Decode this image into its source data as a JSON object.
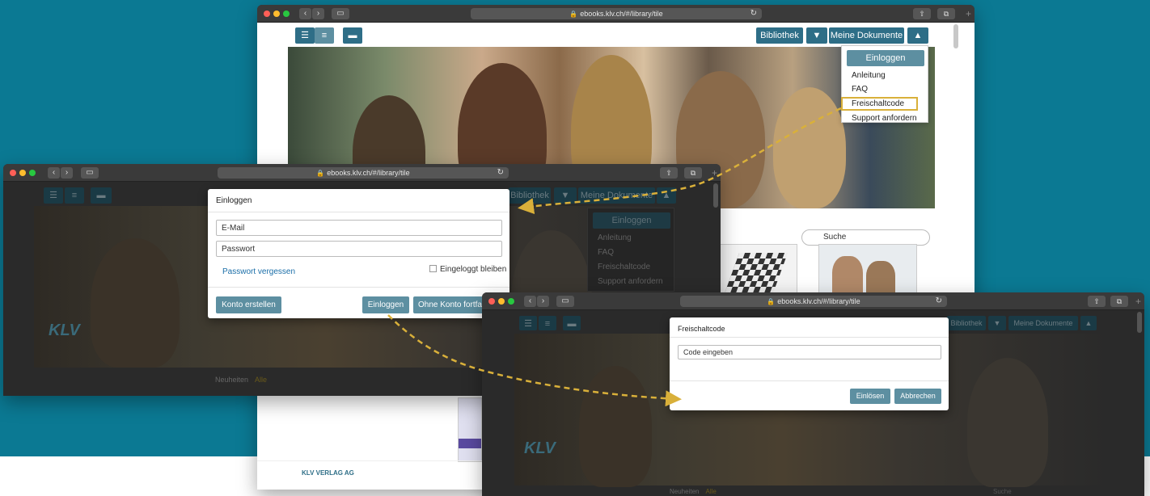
{
  "main_browser": {
    "url": "ebooks.klv.ch/#/library/tile",
    "nav": {
      "bibliothek": "Bibliothek",
      "meine_dokumente": "Meine Dokumente"
    },
    "menu": {
      "login": "Einloggen",
      "items": [
        "Anleitung",
        "FAQ",
        "Freischaltcode",
        "Support anfordern"
      ]
    },
    "search_placeholder": "Suche",
    "footer_logo": "KLV VERLAG AG"
  },
  "login_browser": {
    "url": "ebooks.klv.ch/#/library/tile",
    "nav": {
      "bibliothek": "Bibliothek",
      "meine_dokumente": "Meine Dokumente"
    },
    "menu": {
      "login": "Einloggen",
      "items": [
        "Anleitung",
        "FAQ",
        "Freischaltcode",
        "Support anfordern"
      ]
    },
    "logo": "KLV",
    "tabs": {
      "neuheiten": "Neuheiten",
      "alle": "Alle"
    },
    "modal": {
      "title": "Einloggen",
      "email_placeholder": "E-Mail",
      "password_placeholder": "Passwort",
      "forgot": "Passwort vergessen",
      "remember": "Eingeloggt bleiben",
      "create_account": "Konto erstellen",
      "login": "Einloggen",
      "continue_without": "Ohne Konto fortfahren"
    }
  },
  "code_browser": {
    "url": "ebooks.klv.ch/#/library/tile",
    "nav": {
      "bibliothek": "Bibliothek",
      "meine_dokumente": "Meine Dokumente"
    },
    "logo": "KLV",
    "tabs": {
      "neuheiten": "Neuheiten",
      "alle": "Alle"
    },
    "search_placeholder": "Suche",
    "modal": {
      "title": "Freischaltcode",
      "code_placeholder": "Code eingeben",
      "redeem": "Einlösen",
      "cancel": "Abbrechen"
    }
  },
  "colors": {
    "background": "#0b7993",
    "primary": "#2e6e87",
    "button": "#5d8fa1",
    "highlight": "#d9b03a",
    "arrow": "#d9b03a"
  }
}
